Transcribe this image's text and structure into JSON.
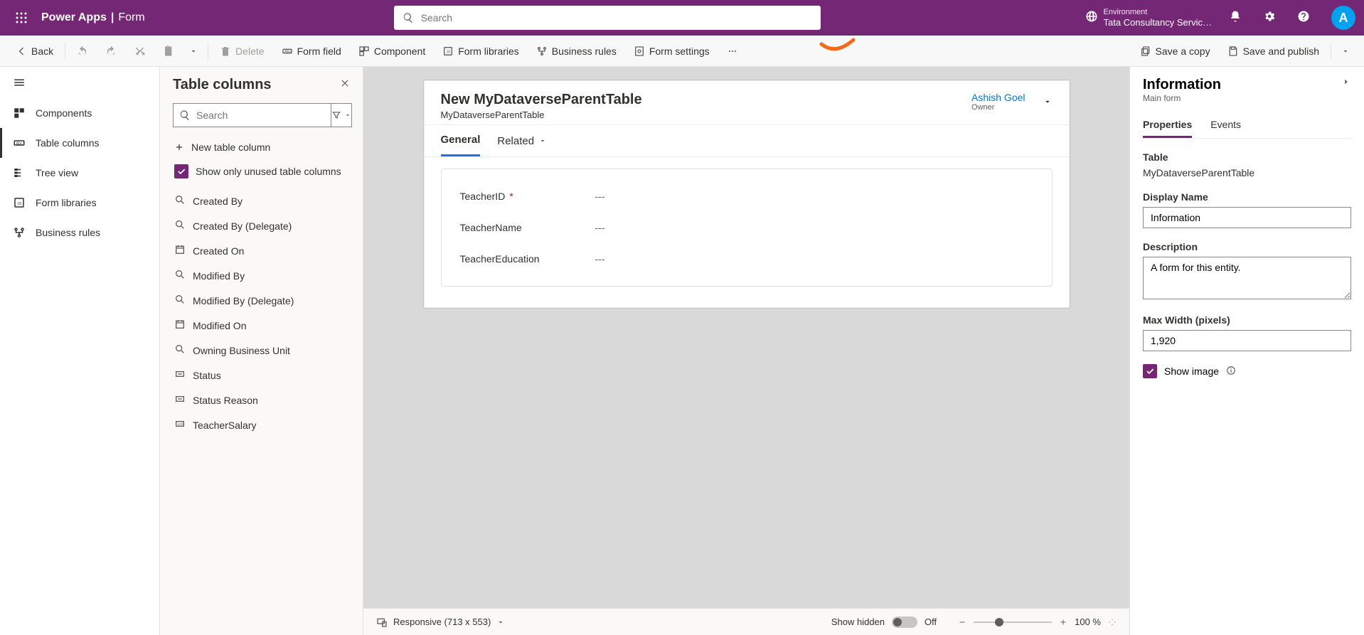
{
  "header": {
    "brand": "Power Apps",
    "section": "Form",
    "search_placeholder": "Search",
    "env_label": "Environment",
    "env_value": "Tata Consultancy Servic…",
    "avatar_letter": "A"
  },
  "cmd": {
    "back": "Back",
    "delete": "Delete",
    "form_field": "Form field",
    "component": "Component",
    "form_libraries": "Form libraries",
    "business_rules": "Business rules",
    "form_settings": "Form settings",
    "save_copy": "Save a copy",
    "save_publish": "Save and publish"
  },
  "leftnav": {
    "components": "Components",
    "table_columns": "Table columns",
    "tree_view": "Tree view",
    "form_libraries": "Form libraries",
    "business_rules": "Business rules"
  },
  "colpanel": {
    "title": "Table columns",
    "search_placeholder": "Search",
    "new_column": "New table column",
    "unused_chk": "Show only unused table columns",
    "items": [
      {
        "label": "Created By",
        "icon": "lookup"
      },
      {
        "label": "Created By (Delegate)",
        "icon": "lookup"
      },
      {
        "label": "Created On",
        "icon": "date"
      },
      {
        "label": "Modified By",
        "icon": "lookup"
      },
      {
        "label": "Modified By (Delegate)",
        "icon": "lookup"
      },
      {
        "label": "Modified On",
        "icon": "date"
      },
      {
        "label": "Owning Business Unit",
        "icon": "lookup"
      },
      {
        "label": "Status",
        "icon": "choice"
      },
      {
        "label": "Status Reason",
        "icon": "choice"
      },
      {
        "label": "TeacherSalary",
        "icon": "number"
      }
    ]
  },
  "form": {
    "title_prefix": "New",
    "title_entity": "MyDataverseParentTable",
    "subtitle": "MyDataverseParentTable",
    "owner_name": "Ashish Goel",
    "owner_label": "Owner",
    "tabs": {
      "general": "General",
      "related": "Related"
    },
    "fields": [
      {
        "label": "TeacherID",
        "required": true,
        "value": "---"
      },
      {
        "label": "TeacherName",
        "required": false,
        "value": "---"
      },
      {
        "label": "TeacherEducation",
        "required": false,
        "value": "---"
      }
    ]
  },
  "footer": {
    "responsive": "Responsive (713 x 553)",
    "show_hidden": "Show hidden",
    "toggle_label": "Off",
    "zoom": "100 %"
  },
  "props": {
    "title": "Information",
    "subtitle": "Main form",
    "tabs": {
      "properties": "Properties",
      "events": "Events"
    },
    "table_label": "Table",
    "table_value": "MyDataverseParentTable",
    "display_label": "Display Name",
    "display_value": "Information",
    "desc_label": "Description",
    "desc_value": "A form for this entity.",
    "maxw_label": "Max Width (pixels)",
    "maxw_value": "1,920",
    "show_image": "Show image"
  }
}
